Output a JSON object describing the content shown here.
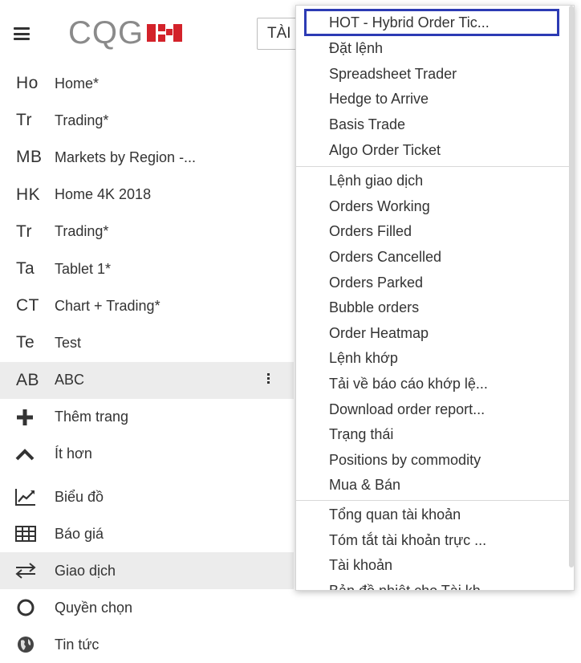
{
  "header": {
    "logo_text": "CQG",
    "tab_label": "TÀI"
  },
  "pages": [
    {
      "abbr": "Ho",
      "label": "Home*"
    },
    {
      "abbr": "Tr",
      "label": "Trading*"
    },
    {
      "abbr": "MB",
      "label": "Markets by Region -..."
    },
    {
      "abbr": "HK",
      "label": "Home 4K 2018"
    },
    {
      "abbr": "Tr",
      "label": "Trading*"
    },
    {
      "abbr": "Ta",
      "label": "Tablet 1*"
    },
    {
      "abbr": "CT",
      "label": "Chart + Trading*"
    },
    {
      "abbr": "Te",
      "label": "Test"
    },
    {
      "abbr": "AB",
      "label": "ABC"
    }
  ],
  "actions": {
    "add_page": "Thêm trang",
    "less": "Ít hơn"
  },
  "nav": {
    "chart": "Biểu đồ",
    "quotes": "Báo giá",
    "trading": "Giao dịch",
    "options": "Quyền chọn",
    "news": "Tin tức"
  },
  "dropdown": {
    "group1": [
      "HOT - Hybrid Order Tic...",
      "Đặt lệnh",
      "Spreadsheet Trader",
      "Hedge to Arrive",
      "Basis Trade",
      "Algo Order Ticket"
    ],
    "group2": [
      "Lệnh giao dịch",
      "Orders Working",
      "Orders Filled",
      "Orders Cancelled",
      "Orders Parked",
      "Bubble orders",
      "Order Heatmap",
      "Lệnh khớp",
      "Tải về báo cáo khớp lệ...",
      "Download order report...",
      "Trạng thái",
      "Positions by commodity",
      "Mua & Bán"
    ],
    "group3": [
      "Tổng quan tài khoản",
      "Tóm tắt tài khoản trực ...",
      "Tài khoản",
      "Bản đồ nhiệt cho Tài kh..."
    ]
  },
  "colors": {
    "highlight_border": "#2c3bb4",
    "logo_red": "#d3222a",
    "logo_gray": "#8a8a8a",
    "active_row_bg": "#ececec"
  }
}
